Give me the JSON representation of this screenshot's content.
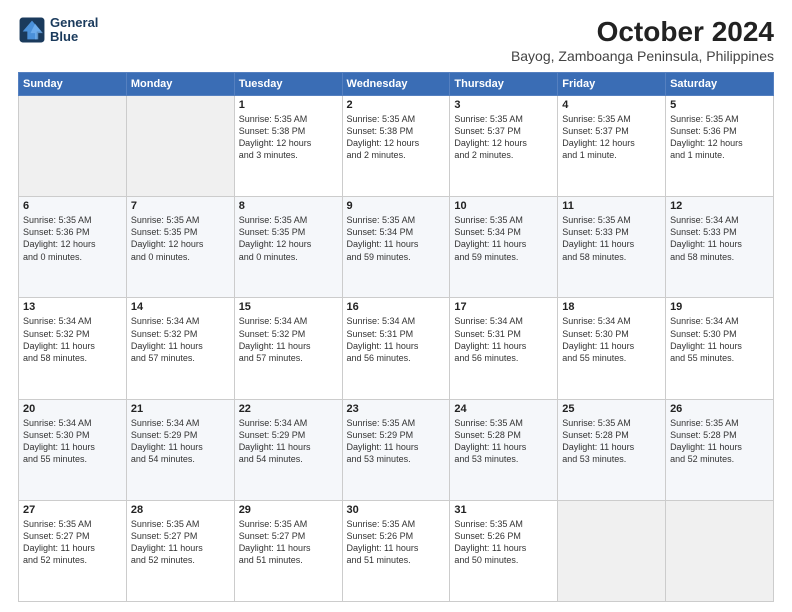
{
  "logo": {
    "line1": "General",
    "line2": "Blue"
  },
  "title": "October 2024",
  "subtitle": "Bayog, Zamboanga Peninsula, Philippines",
  "days_of_week": [
    "Sunday",
    "Monday",
    "Tuesday",
    "Wednesday",
    "Thursday",
    "Friday",
    "Saturday"
  ],
  "weeks": [
    [
      {
        "day": "",
        "info": ""
      },
      {
        "day": "",
        "info": ""
      },
      {
        "day": "1",
        "info": "Sunrise: 5:35 AM\nSunset: 5:38 PM\nDaylight: 12 hours\nand 3 minutes."
      },
      {
        "day": "2",
        "info": "Sunrise: 5:35 AM\nSunset: 5:38 PM\nDaylight: 12 hours\nand 2 minutes."
      },
      {
        "day": "3",
        "info": "Sunrise: 5:35 AM\nSunset: 5:37 PM\nDaylight: 12 hours\nand 2 minutes."
      },
      {
        "day": "4",
        "info": "Sunrise: 5:35 AM\nSunset: 5:37 PM\nDaylight: 12 hours\nand 1 minute."
      },
      {
        "day": "5",
        "info": "Sunrise: 5:35 AM\nSunset: 5:36 PM\nDaylight: 12 hours\nand 1 minute."
      }
    ],
    [
      {
        "day": "6",
        "info": "Sunrise: 5:35 AM\nSunset: 5:36 PM\nDaylight: 12 hours\nand 0 minutes."
      },
      {
        "day": "7",
        "info": "Sunrise: 5:35 AM\nSunset: 5:35 PM\nDaylight: 12 hours\nand 0 minutes."
      },
      {
        "day": "8",
        "info": "Sunrise: 5:35 AM\nSunset: 5:35 PM\nDaylight: 12 hours\nand 0 minutes."
      },
      {
        "day": "9",
        "info": "Sunrise: 5:35 AM\nSunset: 5:34 PM\nDaylight: 11 hours\nand 59 minutes."
      },
      {
        "day": "10",
        "info": "Sunrise: 5:35 AM\nSunset: 5:34 PM\nDaylight: 11 hours\nand 59 minutes."
      },
      {
        "day": "11",
        "info": "Sunrise: 5:35 AM\nSunset: 5:33 PM\nDaylight: 11 hours\nand 58 minutes."
      },
      {
        "day": "12",
        "info": "Sunrise: 5:34 AM\nSunset: 5:33 PM\nDaylight: 11 hours\nand 58 minutes."
      }
    ],
    [
      {
        "day": "13",
        "info": "Sunrise: 5:34 AM\nSunset: 5:32 PM\nDaylight: 11 hours\nand 58 minutes."
      },
      {
        "day": "14",
        "info": "Sunrise: 5:34 AM\nSunset: 5:32 PM\nDaylight: 11 hours\nand 57 minutes."
      },
      {
        "day": "15",
        "info": "Sunrise: 5:34 AM\nSunset: 5:32 PM\nDaylight: 11 hours\nand 57 minutes."
      },
      {
        "day": "16",
        "info": "Sunrise: 5:34 AM\nSunset: 5:31 PM\nDaylight: 11 hours\nand 56 minutes."
      },
      {
        "day": "17",
        "info": "Sunrise: 5:34 AM\nSunset: 5:31 PM\nDaylight: 11 hours\nand 56 minutes."
      },
      {
        "day": "18",
        "info": "Sunrise: 5:34 AM\nSunset: 5:30 PM\nDaylight: 11 hours\nand 55 minutes."
      },
      {
        "day": "19",
        "info": "Sunrise: 5:34 AM\nSunset: 5:30 PM\nDaylight: 11 hours\nand 55 minutes."
      }
    ],
    [
      {
        "day": "20",
        "info": "Sunrise: 5:34 AM\nSunset: 5:30 PM\nDaylight: 11 hours\nand 55 minutes."
      },
      {
        "day": "21",
        "info": "Sunrise: 5:34 AM\nSunset: 5:29 PM\nDaylight: 11 hours\nand 54 minutes."
      },
      {
        "day": "22",
        "info": "Sunrise: 5:34 AM\nSunset: 5:29 PM\nDaylight: 11 hours\nand 54 minutes."
      },
      {
        "day": "23",
        "info": "Sunrise: 5:35 AM\nSunset: 5:29 PM\nDaylight: 11 hours\nand 53 minutes."
      },
      {
        "day": "24",
        "info": "Sunrise: 5:35 AM\nSunset: 5:28 PM\nDaylight: 11 hours\nand 53 minutes."
      },
      {
        "day": "25",
        "info": "Sunrise: 5:35 AM\nSunset: 5:28 PM\nDaylight: 11 hours\nand 53 minutes."
      },
      {
        "day": "26",
        "info": "Sunrise: 5:35 AM\nSunset: 5:28 PM\nDaylight: 11 hours\nand 52 minutes."
      }
    ],
    [
      {
        "day": "27",
        "info": "Sunrise: 5:35 AM\nSunset: 5:27 PM\nDaylight: 11 hours\nand 52 minutes."
      },
      {
        "day": "28",
        "info": "Sunrise: 5:35 AM\nSunset: 5:27 PM\nDaylight: 11 hours\nand 52 minutes."
      },
      {
        "day": "29",
        "info": "Sunrise: 5:35 AM\nSunset: 5:27 PM\nDaylight: 11 hours\nand 51 minutes."
      },
      {
        "day": "30",
        "info": "Sunrise: 5:35 AM\nSunset: 5:26 PM\nDaylight: 11 hours\nand 51 minutes."
      },
      {
        "day": "31",
        "info": "Sunrise: 5:35 AM\nSunset: 5:26 PM\nDaylight: 11 hours\nand 50 minutes."
      },
      {
        "day": "",
        "info": ""
      },
      {
        "day": "",
        "info": ""
      }
    ]
  ]
}
